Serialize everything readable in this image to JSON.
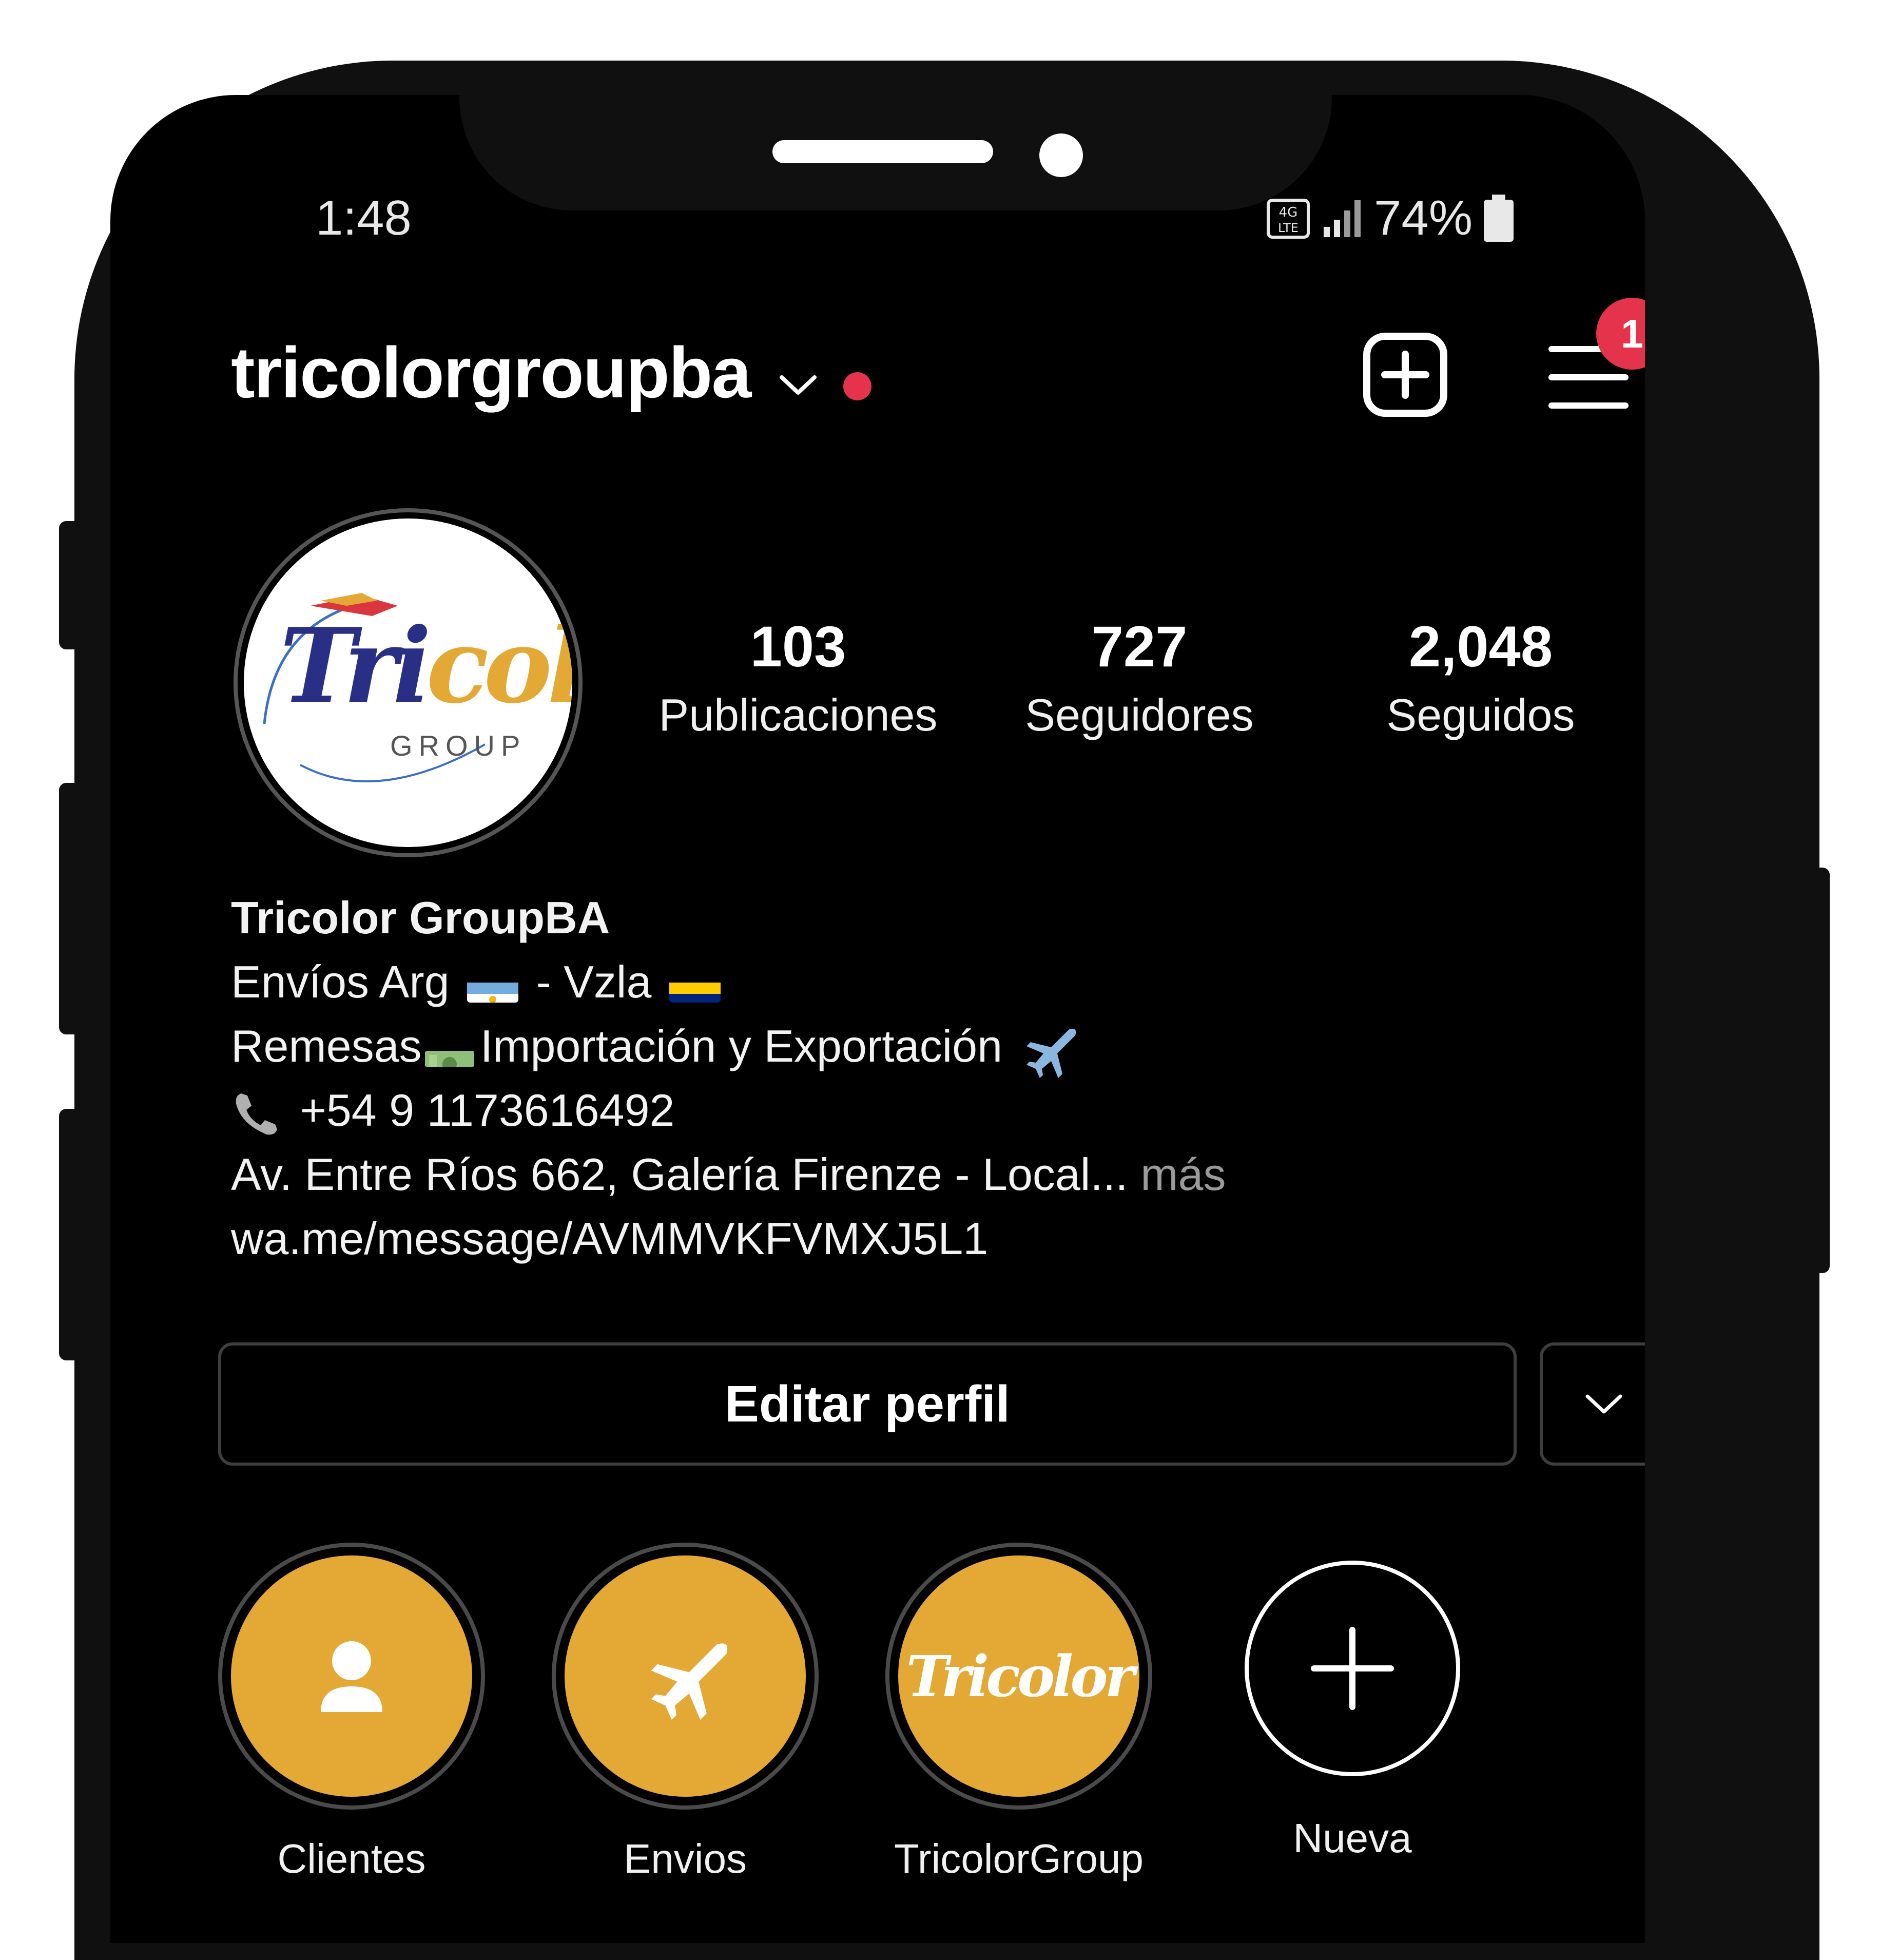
{
  "status_bar": {
    "time": "1:48",
    "battery": "74%"
  },
  "header": {
    "username": "tricolorgroupba",
    "notification_count": "1"
  },
  "profile": {
    "avatar_brand": "Tricolor",
    "avatar_sub": "GROUP"
  },
  "stats": [
    {
      "value": "103",
      "label": "Publicaciones"
    },
    {
      "value": "727",
      "label": "Seguidores"
    },
    {
      "value": "2,048",
      "label": "Seguidos"
    }
  ],
  "bio": {
    "name": "Tricolor GroupBA",
    "line1_a": "Envíos Arg",
    "line1_b": "- Vzla",
    "line2_a": "Remesas",
    "line2_b": "Importación y Exportación",
    "phone": "+54 9 1173616492",
    "address": "Av. Entre Ríos 662, Galería Firenze - Local...",
    "more": "más",
    "link": "wa.me/message/AVMMVKFVMXJ5L1"
  },
  "actions": {
    "edit_profile": "Editar perfil"
  },
  "highlights": [
    {
      "label": "Clientes",
      "icon": "person-icon"
    },
    {
      "label": "Envios",
      "icon": "airplane-icon"
    },
    {
      "label": "TricolorGroup",
      "icon": "tricolor-logo"
    },
    {
      "label": "Nueva",
      "icon": "plus-icon"
    }
  ],
  "colors": {
    "background": "#000000",
    "highlight_fill": "#e4a934",
    "badge_red": "#e5334b",
    "brand_blue": "#2a2f86",
    "brand_yellow": "#e4a934"
  }
}
